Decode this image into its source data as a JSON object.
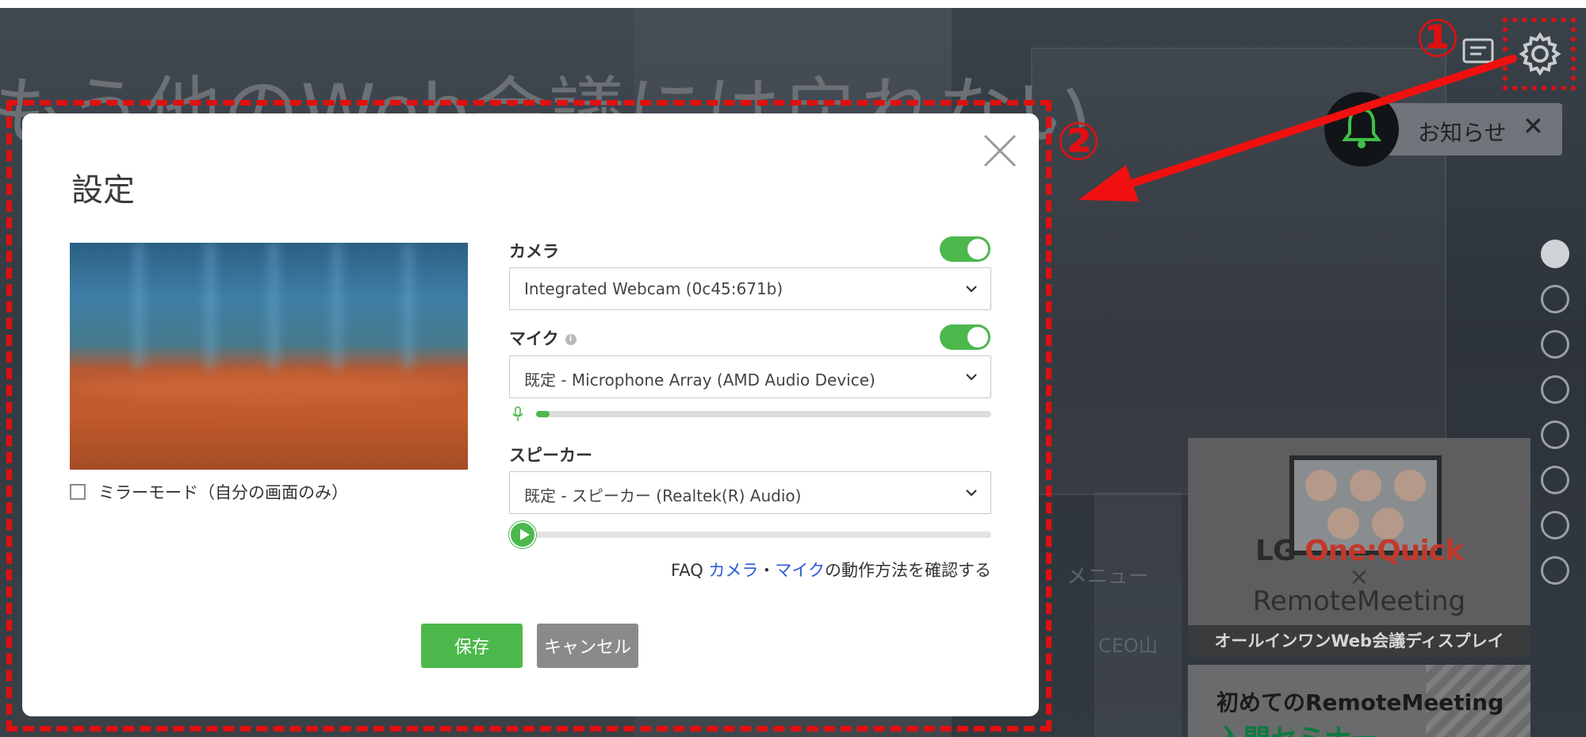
{
  "background": {
    "headline": "もう他のWeb会議には戻れない",
    "menu_text": "メニュー",
    "ceo_text": "CEO山"
  },
  "annotations": {
    "marker1": "①",
    "marker2": "②",
    "color": "#e01010"
  },
  "topbar": {
    "notification_label": "お知らせ",
    "notification_close": "✕"
  },
  "modal": {
    "title": "設定",
    "camera": {
      "label": "カメラ",
      "enabled": true,
      "selected": "Integrated Webcam (0c45:671b)"
    },
    "mic": {
      "label": "マイク",
      "info_icon": "i",
      "enabled": true,
      "selected": "既定 - Microphone Array (AMD Audio Device)",
      "level": 0.03
    },
    "speaker": {
      "label": "スピーカー",
      "selected": "既定 - スピーカー (Realtek(R) Audio)"
    },
    "mirror_mode_label": "ミラーモード（自分の画面のみ）",
    "faq": {
      "prefix": "FAQ ",
      "link_camera": "カメラ",
      "separator": "・",
      "link_mic": "マイク",
      "suffix": "の動作方法を確認する"
    },
    "save_label": "保存",
    "cancel_label": "キャンセル"
  },
  "ads": {
    "ad1": {
      "brand_prefix": "LG ",
      "brand_accent": "One:Quick",
      "times": "×",
      "product": "RemoteMeeting",
      "caption": "オールインワンWeb会議ディスプレイ"
    },
    "ad2": {
      "title": "初めてのRemoteMeeting",
      "subtitle": "入門セミナー"
    }
  },
  "pager": {
    "count": 8,
    "active_index": 0
  },
  "colors": {
    "accent_green": "#4cb84c",
    "cancel_gray": "#8a8a8a",
    "link_blue": "#2a5bd7"
  }
}
